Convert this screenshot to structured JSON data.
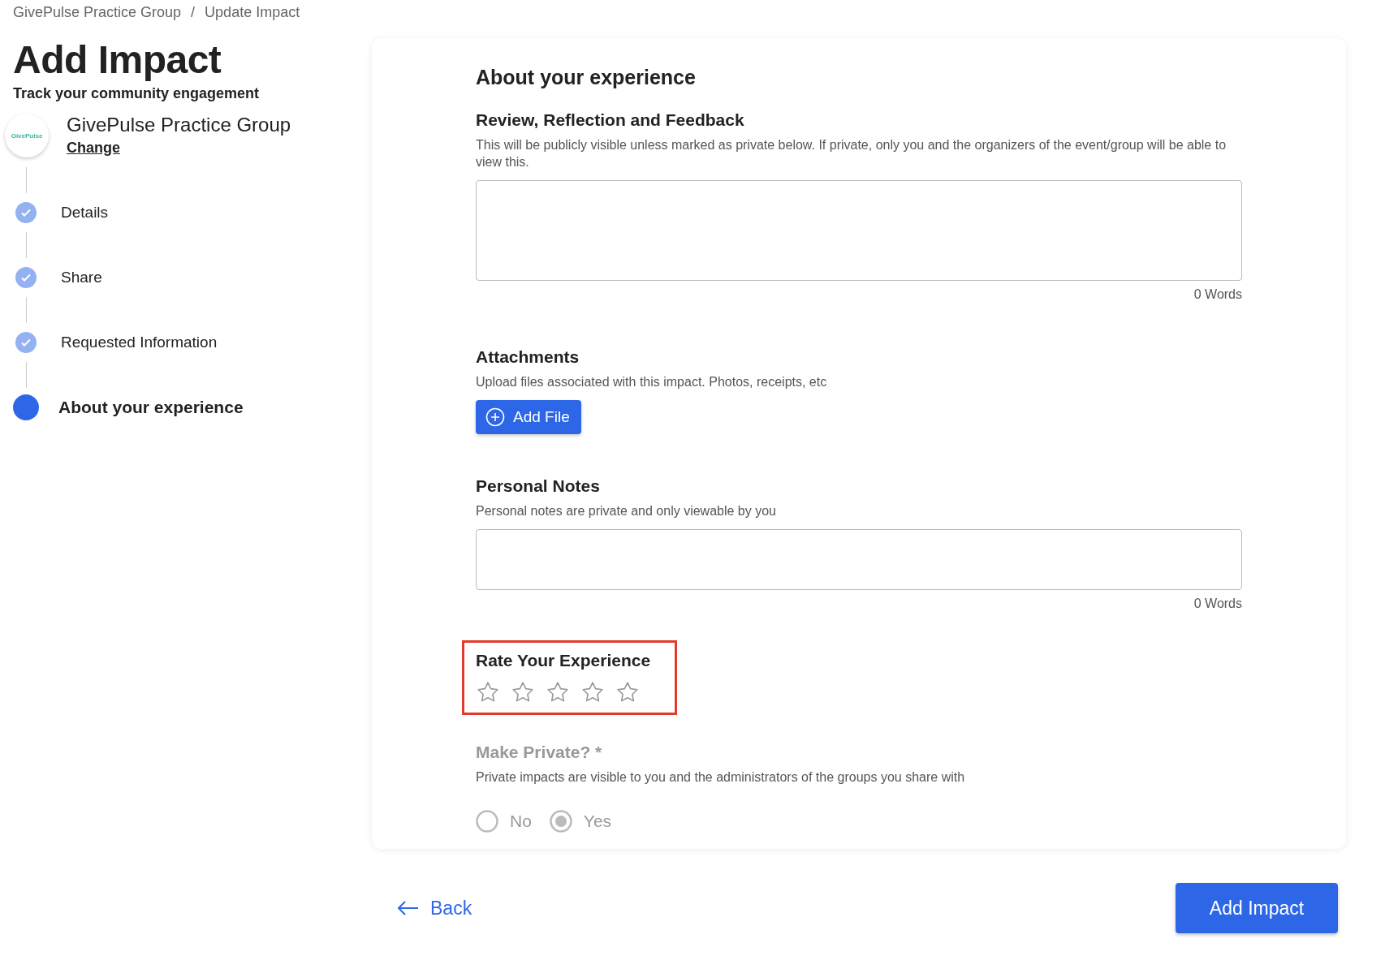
{
  "breadcrumb": [
    "GivePulse Practice Group",
    "Update Impact"
  ],
  "breadcrumb_separator": "/",
  "page": {
    "title": "Add Impact",
    "subtitle": "Track your community engagement"
  },
  "group": {
    "logo_text": "GivePulse",
    "name": "GivePulse Practice Group",
    "change_link": "Change"
  },
  "steps": [
    {
      "label": "Details",
      "completed": true,
      "selected": false
    },
    {
      "label": "Share",
      "completed": true,
      "selected": false
    },
    {
      "label": "Requested Information",
      "completed": true,
      "selected": false
    },
    {
      "label": "About your experience",
      "completed": false,
      "selected": true
    }
  ],
  "form": {
    "heading": "About your experience",
    "review": {
      "label": "Review, Reflection and Feedback",
      "help": "This will be publicly visible unless marked as private below. If private, only you and the organizers of the event/group will be able to view this.",
      "word_count": "0 Words"
    },
    "attachments": {
      "label": "Attachments",
      "help": "Upload files associated with this impact. Photos, receipts, etc",
      "button": "Add File"
    },
    "notes": {
      "label": "Personal Notes",
      "help": "Personal notes are private and only viewable by you",
      "word_count": "0 Words"
    },
    "rating": {
      "label": "Rate Your Experience",
      "stars": 0,
      "highlighted": true
    },
    "private": {
      "label": "Make Private? *",
      "help": "Private impacts are visible to you and the administrators of the groups you share with",
      "disabled": true,
      "options": [
        {
          "label": "No",
          "selected": false
        },
        {
          "label": "Yes",
          "selected": true
        }
      ]
    }
  },
  "footer": {
    "back": "Back",
    "submit": "Add Impact"
  }
}
